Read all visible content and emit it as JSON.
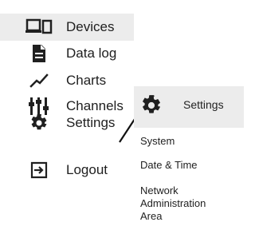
{
  "nav": {
    "items": [
      {
        "icon": "devices-icon",
        "label": "Devices",
        "active": true
      },
      {
        "icon": "document-icon",
        "label": "Data log",
        "active": false
      },
      {
        "icon": "chart-line-icon",
        "label": "Charts",
        "active": false
      },
      {
        "icon": "channels-icon",
        "label": "Channels",
        "active": false
      },
      {
        "icon": "gear-icon",
        "label": "Settings",
        "active": false
      },
      {
        "icon": "logout-icon",
        "label": "Logout",
        "active": false
      }
    ]
  },
  "submenu": {
    "header": {
      "icon": "gear-icon",
      "label": "Settings"
    },
    "items": [
      "System",
      "Date & Time"
    ],
    "network_lines": [
      "Network",
      "Administration",
      "Area"
    ]
  }
}
